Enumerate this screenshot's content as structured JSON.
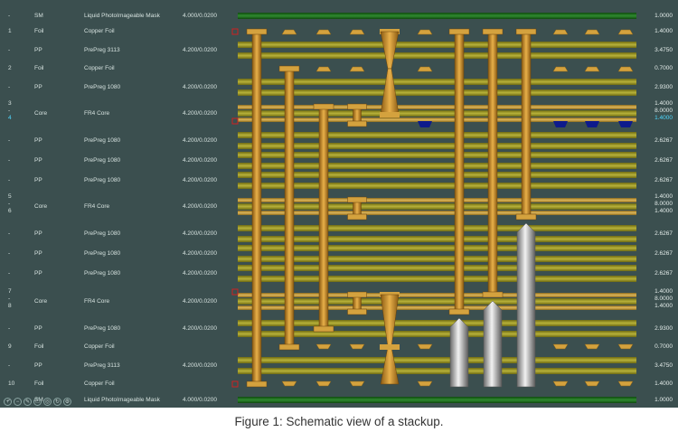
{
  "layers": [
    {
      "num": "-",
      "type": "SM",
      "material": "Liquid PhotoImageable Mask",
      "thickness": "4.000/0.0200",
      "dims": [
        "1.0000"
      ],
      "kind": "mask"
    },
    {
      "num": "1",
      "type": "Foil",
      "material": "Copper Foil",
      "thickness": "",
      "dims": [
        "1.4000"
      ],
      "kind": "copper"
    },
    {
      "num": "-",
      "type": "PP",
      "material": "PrePreg 3113",
      "thickness": "4.200/0.0200",
      "dims": [
        "3.4750"
      ],
      "kind": "prepreg"
    },
    {
      "num": "2",
      "type": "Foil",
      "material": "Copper Foil",
      "thickness": "",
      "dims": [
        "0.7000"
      ],
      "kind": "copper"
    },
    {
      "num": "-",
      "type": "PP",
      "material": "PrePreg 1080",
      "thickness": "4.200/0.0200",
      "dims": [
        "2.9300"
      ],
      "kind": "prepreg"
    },
    {
      "num": "3\n-\n4",
      "type": "Core",
      "material": "FR4 Core",
      "thickness": "4.200/0.0200",
      "dims": [
        "1.4000",
        "8.0000",
        "1.4000"
      ],
      "kind": "core",
      "highlight_last": true
    },
    {
      "num": "-",
      "type": "PP",
      "material": "PrePreg 1080",
      "thickness": "4.200/0.0200",
      "dims": [
        "2.6267"
      ],
      "kind": "prepreg"
    },
    {
      "num": "-",
      "type": "PP",
      "material": "PrePreg 1080",
      "thickness": "4.200/0.0200",
      "dims": [
        "2.6267"
      ],
      "kind": "prepreg"
    },
    {
      "num": "-",
      "type": "PP",
      "material": "PrePreg 1080",
      "thickness": "4.200/0.0200",
      "dims": [
        "2.6267"
      ],
      "kind": "prepreg"
    },
    {
      "num": "5\n-\n6",
      "type": "Core",
      "material": "FR4 Core",
      "thickness": "4.200/0.0200",
      "dims": [
        "1.4000",
        "8.0000",
        "1.4000"
      ],
      "kind": "core"
    },
    {
      "num": "-",
      "type": "PP",
      "material": "PrePreg 1080",
      "thickness": "4.200/0.0200",
      "dims": [
        "2.6267"
      ],
      "kind": "prepreg"
    },
    {
      "num": "-",
      "type": "PP",
      "material": "PrePreg 1080",
      "thickness": "4.200/0.0200",
      "dims": [
        "2.6267"
      ],
      "kind": "prepreg"
    },
    {
      "num": "-",
      "type": "PP",
      "material": "PrePreg 1080",
      "thickness": "4.200/0.0200",
      "dims": [
        "2.6267"
      ],
      "kind": "prepreg"
    },
    {
      "num": "7\n-\n8",
      "type": "Core",
      "material": "FR4 Core",
      "thickness": "4.200/0.0200",
      "dims": [
        "1.4000",
        "8.0000",
        "1.4000"
      ],
      "kind": "core"
    },
    {
      "num": "-",
      "type": "PP",
      "material": "PrePreg 1080",
      "thickness": "4.200/0.0200",
      "dims": [
        "2.9300"
      ],
      "kind": "prepreg"
    },
    {
      "num": "9",
      "type": "Foil",
      "material": "Copper Foil",
      "thickness": "",
      "dims": [
        "0.7000"
      ],
      "kind": "copper"
    },
    {
      "num": "-",
      "type": "PP",
      "material": "PrePreg 3113",
      "thickness": "4.200/0.0200",
      "dims": [
        "3.4750"
      ],
      "kind": "prepreg"
    },
    {
      "num": "10",
      "type": "Foil",
      "material": "Copper Foil",
      "thickness": "",
      "dims": [
        "1.4000"
      ],
      "kind": "copper"
    },
    {
      "num": "-",
      "type": "SM",
      "material": "Liquid PhotoImageable Mask",
      "thickness": "4.000/0.0200",
      "dims": [
        "1.0000"
      ],
      "kind": "mask"
    }
  ],
  "colors": {
    "panel": "#3b4f4f",
    "prepreg": "#8a8a1e",
    "core": "#b8902e",
    "copper": "#d9a94a",
    "mask": "#1f6b1f",
    "via": "#c18a22",
    "pad_blue": "#0d1a8c",
    "marker_red": "#cc2222",
    "highlight": "#4fd9ff"
  },
  "toolbar_icons": [
    "zoom-in-icon",
    "zoom-out-icon",
    "pencil-icon",
    "fit-icon",
    "view-icon",
    "refresh-icon",
    "settings-icon"
  ],
  "caption": "Figure 1: Schematic view of a stackup."
}
